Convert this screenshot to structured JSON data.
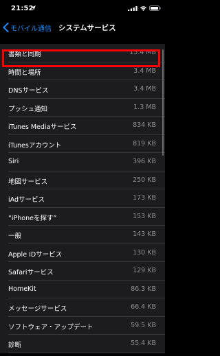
{
  "status_bar": {
    "time": "21:52",
    "icons": [
      "location-arrow-icon",
      "signal-bars-icon",
      "wifi-icon",
      "battery-icon"
    ]
  },
  "nav": {
    "back_label": "モバイル通信",
    "title": "システムサービス"
  },
  "colors": {
    "accent": "#1a8cff",
    "highlight": "#ff0000",
    "row_bg": "#1c1c1e",
    "value_text": "#8e8e93"
  },
  "services": [
    {
      "name": "書類と同期",
      "size": "15.4 MB"
    },
    {
      "name": "時間と場所",
      "size": "3.4 MB"
    },
    {
      "name": "DNSサービス",
      "size": "3.4 MB"
    },
    {
      "name": "プッシュ通知",
      "size": "1.3 MB"
    },
    {
      "name": "iTunes Mediaサービス",
      "size": "834 KB"
    },
    {
      "name": "iTunesアカウント",
      "size": "819 KB"
    },
    {
      "name": "Siri",
      "size": "396 KB"
    },
    {
      "name": "地図サービス",
      "size": "250 KB"
    },
    {
      "name": "iAdサービス",
      "size": "173 KB"
    },
    {
      "name": "“iPhoneを探す”",
      "size": "153 KB"
    },
    {
      "name": "一般",
      "size": "143 KB"
    },
    {
      "name": "Apple IDサービス",
      "size": "130 KB"
    },
    {
      "name": "Safariサービス",
      "size": "129 KB"
    },
    {
      "name": "HomeKit",
      "size": "86.3 KB"
    },
    {
      "name": "メッセージサービス",
      "size": "66.4 KB"
    },
    {
      "name": "ソフトウェア・アップデート",
      "size": "59.5 KB"
    },
    {
      "name": "診断",
      "size": "55.4 KB"
    }
  ]
}
